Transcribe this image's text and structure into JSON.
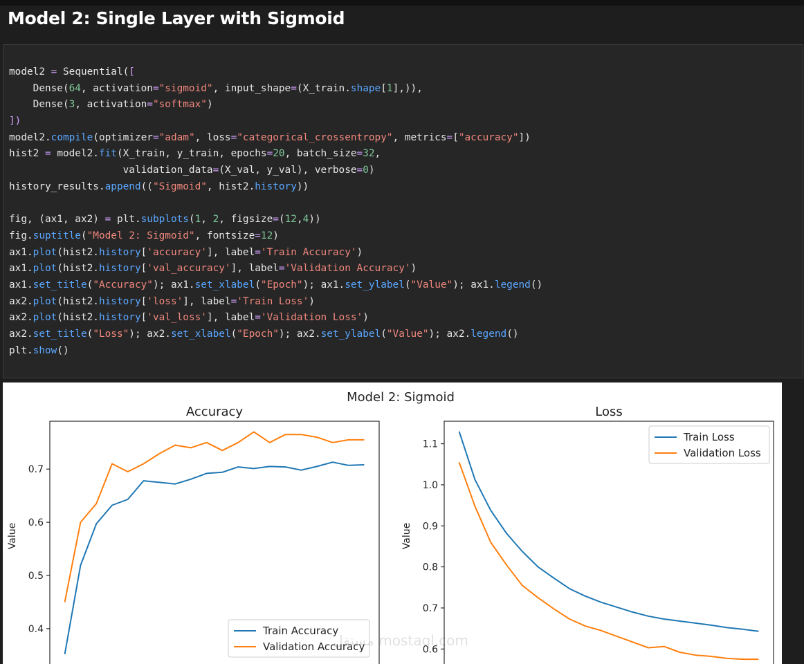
{
  "heading": "Model 2: Single Layer with Sigmoid",
  "code_lines": [
    [
      {
        "t": "model2 "
      },
      {
        "t": "=",
        "c": "op"
      },
      {
        "t": " Sequential("
      },
      {
        "t": "[",
        "c": "op"
      }
    ],
    [
      {
        "t": "    Dense("
      },
      {
        "t": "64",
        "c": "num"
      },
      {
        "t": ", activation"
      },
      {
        "t": "=",
        "c": "op"
      },
      {
        "t": "\"sigmoid\"",
        "c": "str"
      },
      {
        "t": ", input_shape"
      },
      {
        "t": "=",
        "c": "op"
      },
      {
        "t": "(X_train."
      },
      {
        "t": "shape",
        "c": "fn"
      },
      {
        "t": "["
      },
      {
        "t": "1",
        "c": "num"
      },
      {
        "t": "],)),"
      }
    ],
    [
      {
        "t": "    Dense("
      },
      {
        "t": "3",
        "c": "num"
      },
      {
        "t": ", activation"
      },
      {
        "t": "=",
        "c": "op"
      },
      {
        "t": "\"softmax\"",
        "c": "str"
      },
      {
        "t": ")"
      }
    ],
    [
      {
        "t": "])",
        "c": "op"
      }
    ],
    [
      {
        "t": "model2."
      },
      {
        "t": "compile",
        "c": "fn"
      },
      {
        "t": "(optimizer"
      },
      {
        "t": "=",
        "c": "op"
      },
      {
        "t": "\"adam\"",
        "c": "str"
      },
      {
        "t": ", loss"
      },
      {
        "t": "=",
        "c": "op"
      },
      {
        "t": "\"categorical_crossentropy\"",
        "c": "str"
      },
      {
        "t": ", metrics"
      },
      {
        "t": "=",
        "c": "op"
      },
      {
        "t": "["
      },
      {
        "t": "\"accuracy\"",
        "c": "str"
      },
      {
        "t": "])"
      }
    ],
    [
      {
        "t": "hist2 "
      },
      {
        "t": "=",
        "c": "op"
      },
      {
        "t": " model2."
      },
      {
        "t": "fit",
        "c": "fn"
      },
      {
        "t": "(X_train, y_train, epochs"
      },
      {
        "t": "=",
        "c": "op"
      },
      {
        "t": "20",
        "c": "num"
      },
      {
        "t": ", batch_size"
      },
      {
        "t": "=",
        "c": "op"
      },
      {
        "t": "32",
        "c": "num"
      },
      {
        "t": ","
      }
    ],
    [
      {
        "t": "                   validation_data"
      },
      {
        "t": "=",
        "c": "op"
      },
      {
        "t": "(X_val, y_val), verbose"
      },
      {
        "t": "=",
        "c": "op"
      },
      {
        "t": "0",
        "c": "num"
      },
      {
        "t": ")"
      }
    ],
    [
      {
        "t": "history_results."
      },
      {
        "t": "append",
        "c": "fn"
      },
      {
        "t": "(("
      },
      {
        "t": "\"Sigmoid\"",
        "c": "str"
      },
      {
        "t": ", hist2."
      },
      {
        "t": "history",
        "c": "fn"
      },
      {
        "t": "))"
      }
    ],
    [],
    [
      {
        "t": "fig, (ax1, ax2) "
      },
      {
        "t": "=",
        "c": "op"
      },
      {
        "t": " plt."
      },
      {
        "t": "subplots",
        "c": "fn"
      },
      {
        "t": "("
      },
      {
        "t": "1",
        "c": "num"
      },
      {
        "t": ", "
      },
      {
        "t": "2",
        "c": "num"
      },
      {
        "t": ", figsize"
      },
      {
        "t": "=",
        "c": "op"
      },
      {
        "t": "("
      },
      {
        "t": "12",
        "c": "num"
      },
      {
        "t": ","
      },
      {
        "t": "4",
        "c": "num"
      },
      {
        "t": "))"
      }
    ],
    [
      {
        "t": "fig."
      },
      {
        "t": "suptitle",
        "c": "fn"
      },
      {
        "t": "("
      },
      {
        "t": "\"Model 2: Sigmoid\"",
        "c": "str"
      },
      {
        "t": ", fontsize"
      },
      {
        "t": "=",
        "c": "op"
      },
      {
        "t": "12",
        "c": "num"
      },
      {
        "t": ")"
      }
    ],
    [
      {
        "t": "ax1."
      },
      {
        "t": "plot",
        "c": "fn"
      },
      {
        "t": "(hist2."
      },
      {
        "t": "history",
        "c": "fn"
      },
      {
        "t": "["
      },
      {
        "t": "'accuracy'",
        "c": "str"
      },
      {
        "t": "], label"
      },
      {
        "t": "=",
        "c": "op"
      },
      {
        "t": "'Train Accuracy'",
        "c": "str"
      },
      {
        "t": ")"
      }
    ],
    [
      {
        "t": "ax1."
      },
      {
        "t": "plot",
        "c": "fn"
      },
      {
        "t": "(hist2."
      },
      {
        "t": "history",
        "c": "fn"
      },
      {
        "t": "["
      },
      {
        "t": "'val_accuracy'",
        "c": "str"
      },
      {
        "t": "], label"
      },
      {
        "t": "=",
        "c": "op"
      },
      {
        "t": "'Validation Accuracy'",
        "c": "str"
      },
      {
        "t": ")"
      }
    ],
    [
      {
        "t": "ax1."
      },
      {
        "t": "set_title",
        "c": "fn"
      },
      {
        "t": "("
      },
      {
        "t": "\"Accuracy\"",
        "c": "str"
      },
      {
        "t": "); ax1."
      },
      {
        "t": "set_xlabel",
        "c": "fn"
      },
      {
        "t": "("
      },
      {
        "t": "\"Epoch\"",
        "c": "str"
      },
      {
        "t": "); ax1."
      },
      {
        "t": "set_ylabel",
        "c": "fn"
      },
      {
        "t": "("
      },
      {
        "t": "\"Value\"",
        "c": "str"
      },
      {
        "t": "); ax1."
      },
      {
        "t": "legend",
        "c": "fn"
      },
      {
        "t": "()"
      }
    ],
    [
      {
        "t": "ax2."
      },
      {
        "t": "plot",
        "c": "fn"
      },
      {
        "t": "(hist2."
      },
      {
        "t": "history",
        "c": "fn"
      },
      {
        "t": "["
      },
      {
        "t": "'loss'",
        "c": "str"
      },
      {
        "t": "], label"
      },
      {
        "t": "=",
        "c": "op"
      },
      {
        "t": "'Train Loss'",
        "c": "str"
      },
      {
        "t": ")"
      }
    ],
    [
      {
        "t": "ax2."
      },
      {
        "t": "plot",
        "c": "fn"
      },
      {
        "t": "(hist2."
      },
      {
        "t": "history",
        "c": "fn"
      },
      {
        "t": "["
      },
      {
        "t": "'val_loss'",
        "c": "str"
      },
      {
        "t": "], label"
      },
      {
        "t": "=",
        "c": "op"
      },
      {
        "t": "'Validation Loss'",
        "c": "str"
      },
      {
        "t": ")"
      }
    ],
    [
      {
        "t": "ax2."
      },
      {
        "t": "set_title",
        "c": "fn"
      },
      {
        "t": "("
      },
      {
        "t": "\"Loss\"",
        "c": "str"
      },
      {
        "t": "); ax2."
      },
      {
        "t": "set_xlabel",
        "c": "fn"
      },
      {
        "t": "("
      },
      {
        "t": "\"Epoch\"",
        "c": "str"
      },
      {
        "t": "); ax2."
      },
      {
        "t": "set_ylabel",
        "c": "fn"
      },
      {
        "t": "("
      },
      {
        "t": "\"Value\"",
        "c": "str"
      },
      {
        "t": "); ax2."
      },
      {
        "t": "legend",
        "c": "fn"
      },
      {
        "t": "()"
      }
    ],
    [
      {
        "t": "plt."
      },
      {
        "t": "show",
        "c": "fn"
      },
      {
        "t": "()"
      }
    ]
  ],
  "colors": {
    "train": "#1f77b4",
    "validation": "#ff7f0e",
    "operator": "#d4a2ff",
    "string": "#f0877d",
    "number": "#7ec699",
    "function": "#5aa7ff"
  },
  "figure_title": "Model 2: Sigmoid",
  "watermark": "مستقل mostaql.com",
  "chart_data": [
    {
      "type": "line",
      "title": "Accuracy",
      "xlabel": "",
      "ylabel": "Value",
      "x": [
        0,
        1,
        2,
        3,
        4,
        5,
        6,
        7,
        8,
        9,
        10,
        11,
        12,
        13,
        14,
        15,
        16,
        17,
        18,
        19
      ],
      "xlim": [
        -0.95,
        19.95
      ],
      "ylim": [
        0.327,
        0.79
      ],
      "yticks": [
        0.4,
        0.5,
        0.6,
        0.7
      ],
      "ytick_labels": [
        "0.4",
        "0.5",
        "0.6",
        "0.7"
      ],
      "legend": "lower center",
      "series": [
        {
          "name": "Train Accuracy",
          "values": [
            0.352,
            0.519,
            0.597,
            0.632,
            0.643,
            0.678,
            0.675,
            0.672,
            0.681,
            0.692,
            0.694,
            0.704,
            0.701,
            0.705,
            0.704,
            0.698,
            0.705,
            0.713,
            0.707,
            0.708
          ]
        },
        {
          "name": "Validation Accuracy",
          "values": [
            0.45,
            0.6,
            0.635,
            0.71,
            0.695,
            0.71,
            0.729,
            0.745,
            0.74,
            0.75,
            0.735,
            0.75,
            0.77,
            0.75,
            0.765,
            0.765,
            0.76,
            0.75,
            0.755,
            0.755
          ]
        }
      ]
    },
    {
      "type": "line",
      "title": "Loss",
      "xlabel": "",
      "ylabel": "Value",
      "x": [
        0,
        1,
        2,
        3,
        4,
        5,
        6,
        7,
        8,
        9,
        10,
        11,
        12,
        13,
        14,
        15,
        16,
        17,
        18,
        19
      ],
      "xlim": [
        -0.95,
        19.95
      ],
      "ylim": [
        0.555,
        1.155
      ],
      "yticks": [
        0.6,
        0.7,
        0.8,
        0.9,
        1.0,
        1.1
      ],
      "ytick_labels": [
        "0.6",
        "0.7",
        "0.8",
        "0.9",
        "1.0",
        "1.1"
      ],
      "legend": "upper right",
      "series": [
        {
          "name": "Train Loss",
          "values": [
            1.13,
            1.013,
            0.938,
            0.882,
            0.838,
            0.8,
            0.773,
            0.747,
            0.729,
            0.714,
            0.702,
            0.69,
            0.68,
            0.673,
            0.668,
            0.663,
            0.658,
            0.652,
            0.648,
            0.643
          ]
        },
        {
          "name": "Validation Loss",
          "values": [
            1.055,
            0.948,
            0.86,
            0.805,
            0.755,
            0.725,
            0.698,
            0.673,
            0.656,
            0.645,
            0.631,
            0.617,
            0.603,
            0.606,
            0.592,
            0.585,
            0.582,
            0.577,
            0.575,
            0.575
          ]
        }
      ]
    }
  ]
}
